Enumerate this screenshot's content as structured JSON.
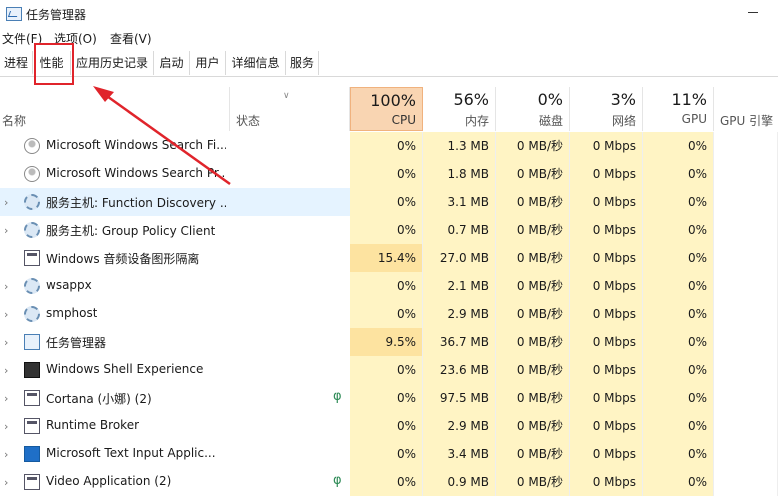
{
  "window": {
    "title": "任务管理器"
  },
  "menu": [
    "文件(F)",
    "选项(O)",
    "查看(V)"
  ],
  "tabs": [
    "进程",
    "性能",
    "应用历史记录",
    "启动",
    "用户",
    "详细信息",
    "服务"
  ],
  "columns": {
    "name": "名称",
    "status": "状态",
    "cpu": {
      "pct": "100%",
      "label": "CPU"
    },
    "memory": {
      "pct": "56%",
      "label": "内存"
    },
    "disk": {
      "pct": "0%",
      "label": "磁盘"
    },
    "network": {
      "pct": "3%",
      "label": "网络"
    },
    "gpu": {
      "pct": "11%",
      "label": "GPU"
    },
    "gpu_engine": {
      "label": "GPU 引擎"
    }
  },
  "processes": [
    {
      "name": "Microsoft Windows Search Fi...",
      "icon": "user-icon",
      "cpu": "0%",
      "mem": "1.3 MB",
      "disk": "0 MB/秒",
      "net": "0 Mbps",
      "gpu": "0%"
    },
    {
      "name": "Microsoft Windows Search Pr...",
      "icon": "user-icon",
      "cpu": "0%",
      "mem": "1.8 MB",
      "disk": "0 MB/秒",
      "net": "0 Mbps",
      "gpu": "0%"
    },
    {
      "name": "服务主机: Function Discovery ...",
      "icon": "gear-icon",
      "cpu": "0%",
      "mem": "3.1 MB",
      "disk": "0 MB/秒",
      "net": "0 Mbps",
      "gpu": "0%"
    },
    {
      "name": "服务主机: Group Policy Client",
      "icon": "gear-icon",
      "cpu": "0%",
      "mem": "0.7 MB",
      "disk": "0 MB/秒",
      "net": "0 Mbps",
      "gpu": "0%"
    },
    {
      "name": "Windows 音频设备图形隔离",
      "icon": "app-icon",
      "cpu": "15.4%",
      "mem": "27.0 MB",
      "disk": "0 MB/秒",
      "net": "0 Mbps",
      "gpu": "0%"
    },
    {
      "name": "wsappx",
      "icon": "gear-icon",
      "cpu": "0%",
      "mem": "2.1 MB",
      "disk": "0 MB/秒",
      "net": "0 Mbps",
      "gpu": "0%"
    },
    {
      "name": "smphost",
      "icon": "gear-icon",
      "cpu": "0%",
      "mem": "2.9 MB",
      "disk": "0 MB/秒",
      "net": "0 Mbps",
      "gpu": "0%"
    },
    {
      "name": "任务管理器",
      "icon": "task-manager-icon",
      "cpu": "9.5%",
      "mem": "36.7 MB",
      "disk": "0 MB/秒",
      "net": "0 Mbps",
      "gpu": "0%"
    },
    {
      "name": "Windows Shell Experience",
      "icon": "shell-icon",
      "cpu": "0%",
      "mem": "23.6 MB",
      "disk": "0 MB/秒",
      "net": "0 Mbps",
      "gpu": "0%"
    },
    {
      "name": "Cortana (小娜) (2)",
      "icon": "app-icon",
      "cpu": "0%",
      "mem": "97.5 MB",
      "disk": "0 MB/秒",
      "net": "0 Mbps",
      "gpu": "0%"
    },
    {
      "name": "Runtime Broker",
      "icon": "app-icon",
      "cpu": "0%",
      "mem": "2.9 MB",
      "disk": "0 MB/秒",
      "net": "0 Mbps",
      "gpu": "0%"
    },
    {
      "name": "Microsoft Text Input Applic...",
      "icon": "blue-app-icon",
      "cpu": "0%",
      "mem": "3.4 MB",
      "disk": "0 MB/秒",
      "net": "0 Mbps",
      "gpu": "0%"
    },
    {
      "name": "Video Application (2)",
      "icon": "app-icon",
      "cpu": "0%",
      "mem": "0.9 MB",
      "disk": "0 MB/秒",
      "net": "0 Mbps",
      "gpu": "0%"
    }
  ]
}
